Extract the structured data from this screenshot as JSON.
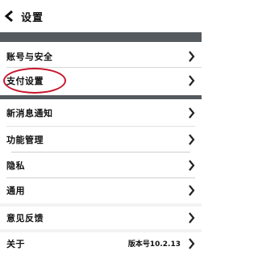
{
  "header": {
    "title": "设置",
    "back_icon": "chevron-left-icon"
  },
  "menu": {
    "account_security": "账号与安全",
    "payment_settings": "支付设置",
    "new_message_notification": "新消息通知",
    "feature_management": "功能管理",
    "privacy": "隐私",
    "general": "通用",
    "feedback": "意见反馈",
    "about": "关于",
    "version": "版本号10.2.13"
  },
  "annotation": {
    "highlight_color": "#c8162b",
    "highlighted_item": "payment_settings"
  },
  "colors": {
    "band": "#555a5e",
    "background": "#ffffff"
  }
}
